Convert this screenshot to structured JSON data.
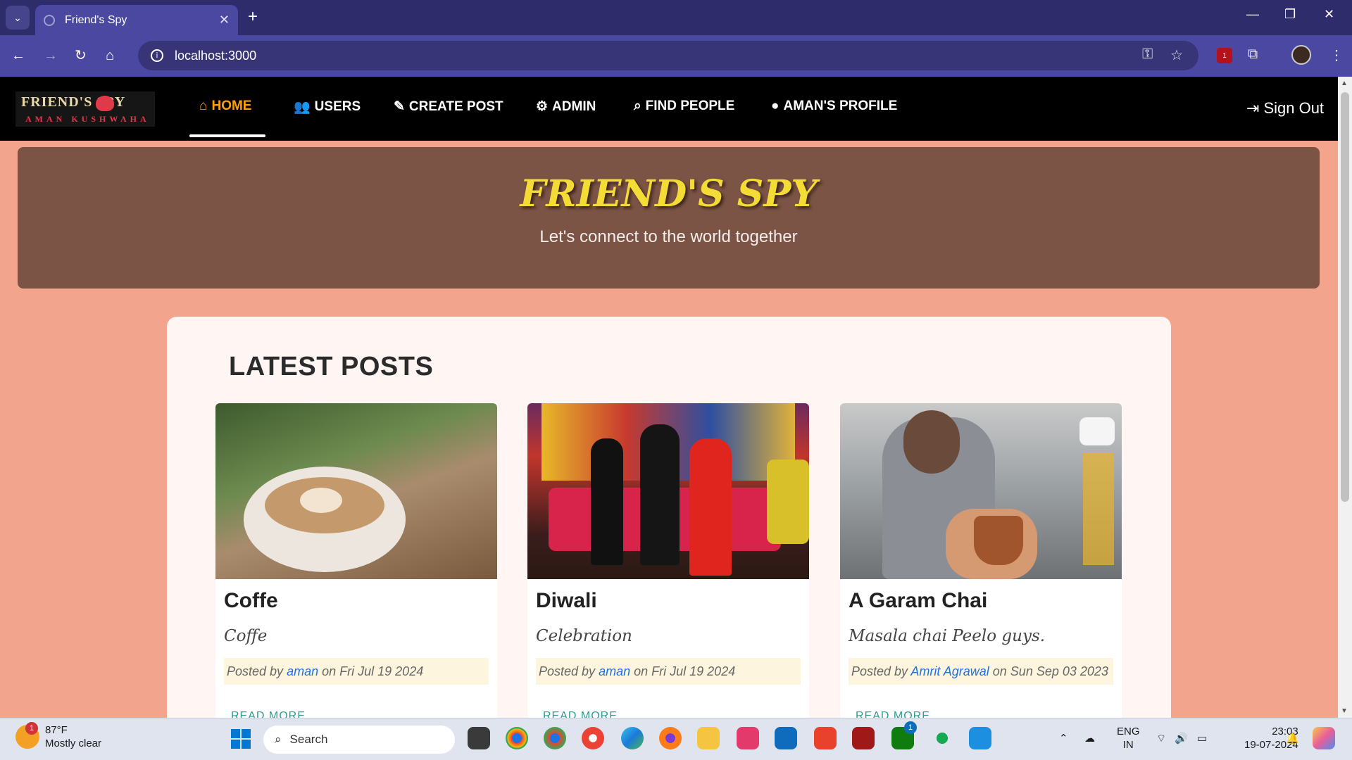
{
  "browser": {
    "tab_title": "Friend's Spy",
    "url": "localhost:3000",
    "ext_badge_count": "1"
  },
  "app": {
    "logo_line1": "FRIEND'S SPY",
    "logo_line2": "AMAN KUSHWAHA",
    "nav": [
      {
        "label": "HOME",
        "icon": "home-icon"
      },
      {
        "label": "USERS",
        "icon": "users-icon"
      },
      {
        "label": "CREATE POST",
        "icon": "edit-icon"
      },
      {
        "label": "ADMIN",
        "icon": "gears-icon"
      },
      {
        "label": "FIND PEOPLE",
        "icon": "search-icon"
      },
      {
        "label": "AMAN'S PROFILE",
        "icon": "user-circle-icon"
      }
    ],
    "signout_label": "Sign Out",
    "accent": "#ffa200"
  },
  "hero": {
    "title": "FRIEND'S SPY",
    "subtitle": "Let's connect to the world together"
  },
  "posts": {
    "heading": "LATEST POSTS",
    "items": [
      {
        "title": "Coffe",
        "desc": "Coffe",
        "prefix": "Posted by",
        "author": "aman",
        "date": "on Fri Jul 19 2024",
        "more": "READ MORE"
      },
      {
        "title": "Diwali",
        "desc": "Celebration",
        "prefix": "Posted by",
        "author": "aman",
        "date": "on Fri Jul 19 2024",
        "more": "READ MORE"
      },
      {
        "title": "A Garam Chai",
        "desc": "Masala chai Peelo guys.",
        "prefix": "Posted by",
        "author": "Amrit Agrawal",
        "date": "on Sun Sep 03 2023",
        "more": "READ MORE"
      }
    ]
  },
  "taskbar": {
    "weather_temp": "87°F",
    "weather_desc": "Mostly clear",
    "weather_badge": "1",
    "search_placeholder": "Search",
    "lang_line1": "ENG",
    "lang_line2": "IN",
    "time": "23:03",
    "date": "19-07-2024",
    "xbox_badge": "1"
  }
}
